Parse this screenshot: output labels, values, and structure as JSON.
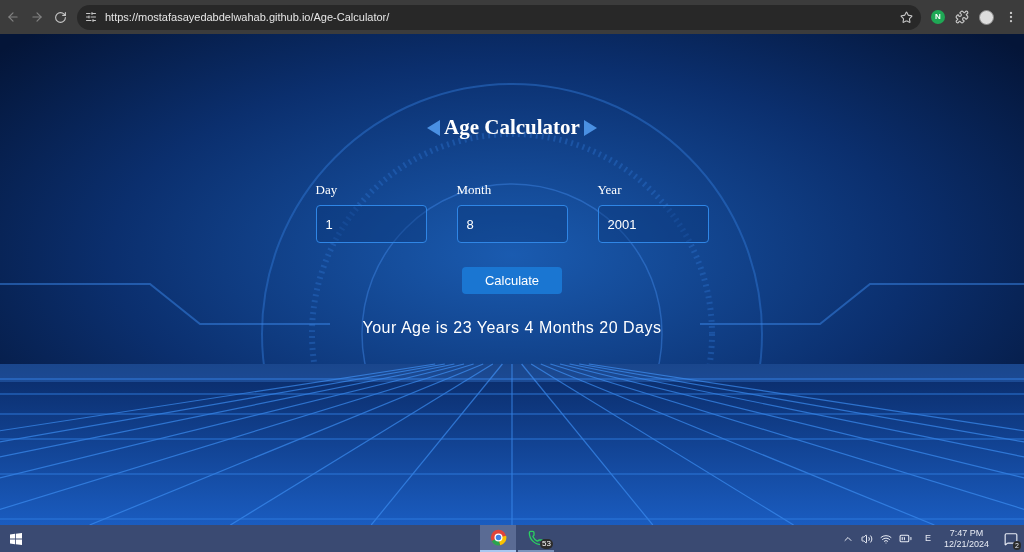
{
  "browser": {
    "url": "https://mostafasayedabdelwahab.github.io/Age-Calculator/",
    "extension_letter": "N"
  },
  "page": {
    "title": "Age Calculator",
    "fields": [
      {
        "label": "Day",
        "value": "1"
      },
      {
        "label": "Month",
        "value": "8"
      },
      {
        "label": "Year",
        "value": "2001"
      }
    ],
    "button": "Calculate",
    "result": "Your Age is 23 Years 4 Months 20 Days"
  },
  "taskbar": {
    "apps": [
      {
        "kind": "chrome",
        "selected": true
      },
      {
        "kind": "whatsapp",
        "selected": false,
        "badge": "53"
      }
    ],
    "language": "E",
    "time": "7:47 PM",
    "date": "12/21/2024",
    "notifications": "2"
  }
}
